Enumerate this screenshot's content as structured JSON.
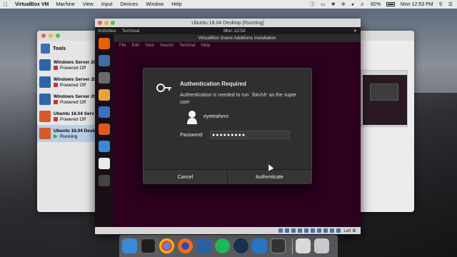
{
  "menubar": {
    "app_name": "VirtualBox VM",
    "menus": [
      "Machine",
      "View",
      "Input",
      "Devices",
      "Window",
      "Help"
    ],
    "battery": "82%",
    "clock": "Mon 12:53 PM"
  },
  "manager": {
    "tools_label": "Tools",
    "vms": [
      {
        "name": "Windows Server 20",
        "status": "Powered Off"
      },
      {
        "name": "Windows Server 20",
        "status": "Powered Off"
      },
      {
        "name": "Windows Server 20",
        "status": "Powered Off"
      },
      {
        "name": "Ubuntu 18.04 Serv",
        "status": "Powered Off"
      },
      {
        "name": "Ubuntu 18.04 Desk",
        "status": "Running"
      }
    ]
  },
  "vm_window": {
    "title": "Ubuntu 18.04 Desktop [Running]",
    "activities": "Activities",
    "app_menu": "Terminal",
    "clock": "Mon 12:53",
    "terminal_title": "VirtualBox Guest Additions installation",
    "terminal_menu": [
      "File",
      "Edit",
      "View",
      "Search",
      "Terminal",
      "Help"
    ],
    "host_key": "Left ⌘"
  },
  "dialog": {
    "title": "Authentication Required",
    "message": "Authentication is needed to run `/bin/sh' as the super user",
    "username": "eyeteahero",
    "password_label": "Password:",
    "password_value": "●●●●●●●●●",
    "cancel_label": "Cancel",
    "authenticate_label": "Authenticate"
  }
}
